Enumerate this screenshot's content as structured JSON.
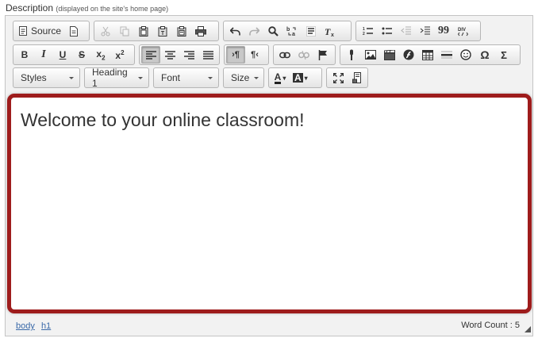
{
  "field": {
    "label": "Description",
    "hint": "(displayed on the site's home page)"
  },
  "toolbar": {
    "source_label": "Source",
    "styles_label": "Styles",
    "format_label": "Heading 1",
    "font_label": "Font",
    "size_label": "Size",
    "text_color_label": "A",
    "bg_color_label": "A",
    "bold_label": "B",
    "italic_label": "I",
    "strike_label": "S",
    "subscript_label": "x",
    "subscript_mark": "2",
    "superscript_label": "x",
    "superscript_mark": "2",
    "omega_label": "Ω",
    "sigma_label": "Σ",
    "quote_label": "99"
  },
  "content": {
    "heading": "Welcome to your online classroom!"
  },
  "statusbar": {
    "path": [
      "body",
      "h1"
    ],
    "word_count": "Word Count : 5"
  },
  "colors": {
    "focus_border": "#9e1c1c",
    "link": "#3a69a8",
    "toolbar_bg": "#f2f2f2"
  }
}
